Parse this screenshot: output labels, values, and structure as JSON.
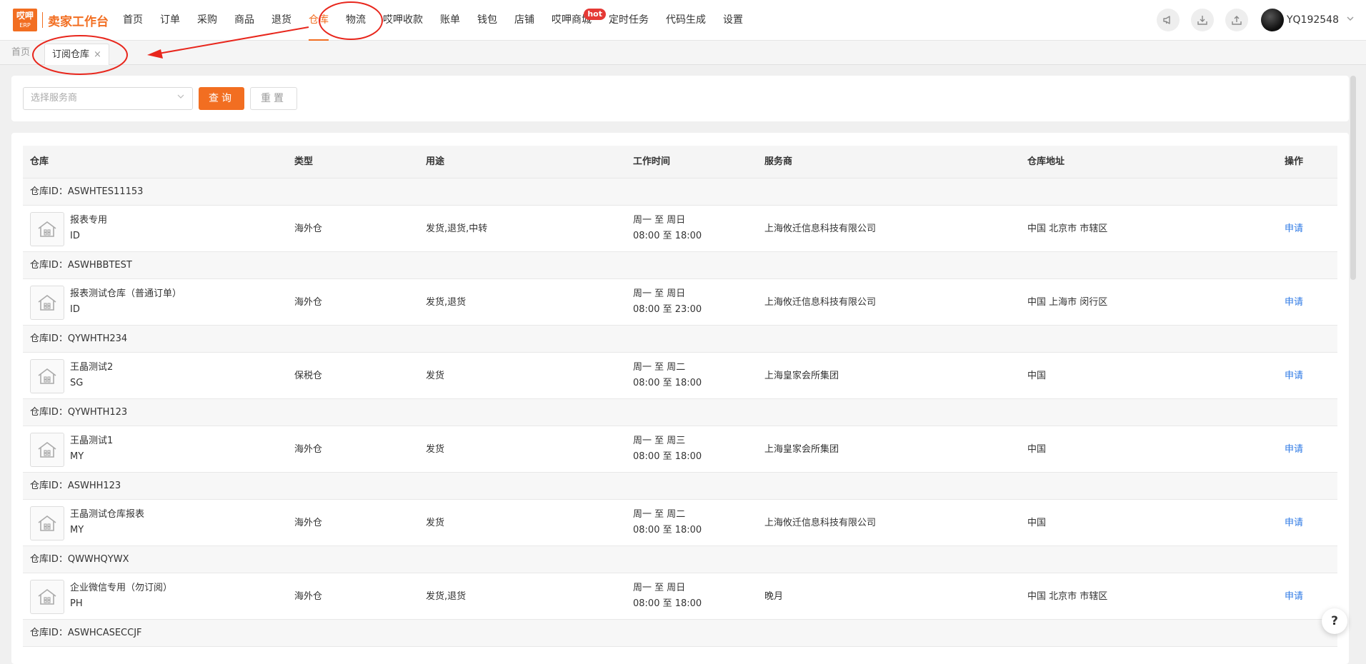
{
  "brand": {
    "logo_line1": "哎呷",
    "logo_line2": "ERP",
    "title": "卖家工作台"
  },
  "colors": {
    "accent": "#f26e21",
    "link": "#2f7ae5",
    "annotation": "#e8261c"
  },
  "nav": [
    {
      "label": "首页"
    },
    {
      "label": "订单"
    },
    {
      "label": "采购"
    },
    {
      "label": "商品"
    },
    {
      "label": "退货"
    },
    {
      "label": "仓库",
      "active": true
    },
    {
      "label": "物流"
    },
    {
      "label": "哎呷收款"
    },
    {
      "label": "账单"
    },
    {
      "label": "钱包"
    },
    {
      "label": "店铺"
    },
    {
      "label": "哎呷商城",
      "badge": "hot"
    },
    {
      "label": "定时任务"
    },
    {
      "label": "代码生成"
    },
    {
      "label": "设置"
    }
  ],
  "top_right": {
    "icons": [
      "megaphone-icon",
      "download-icon",
      "upload-icon"
    ],
    "username": "YQ192548"
  },
  "tabs": {
    "home": "首页",
    "active": "订阅仓库",
    "close": "×"
  },
  "filter": {
    "provider_placeholder": "选择服务商",
    "query_label": "查询",
    "reset_label": "重置"
  },
  "table": {
    "columns": [
      "仓库",
      "类型",
      "用途",
      "工作时间",
      "服务商",
      "仓库地址",
      "操作"
    ],
    "groups": [
      {
        "id_label": "仓库ID：ASWHTES11153",
        "name": "报表专用",
        "code": "ID",
        "type": "海外仓",
        "use": "发货,退货,中转",
        "days": "周一 至 周日",
        "hours": "08:00 至 18:00",
        "provider": "上海攸迁信息科技有限公司",
        "address": "中国 北京市 市辖区",
        "action": "申请"
      },
      {
        "id_label": "仓库ID：ASWHBBTEST",
        "name": "报表测试仓库（普通订单）",
        "code": "ID",
        "type": "海外仓",
        "use": "发货,退货",
        "days": "周一 至 周日",
        "hours": "08:00 至 23:00",
        "provider": "上海攸迁信息科技有限公司",
        "address": "中国 上海市 闵行区",
        "action": "申请"
      },
      {
        "id_label": "仓库ID：QYWHTH234",
        "name": "王晶测试2",
        "code": "SG",
        "type": "保税仓",
        "use": "发货",
        "days": "周一 至 周二",
        "hours": "08:00 至 18:00",
        "provider": "上海皇家会所集团",
        "address": "中国",
        "action": "申请"
      },
      {
        "id_label": "仓库ID：QYWHTH123",
        "name": "王晶测试1",
        "code": "MY",
        "type": "海外仓",
        "use": "发货",
        "days": "周一 至 周三",
        "hours": "08:00 至 18:00",
        "provider": "上海皇家会所集团",
        "address": "中国",
        "action": "申请"
      },
      {
        "id_label": "仓库ID：ASWHH123",
        "name": "王晶测试仓库报表",
        "code": "MY",
        "type": "海外仓",
        "use": "发货",
        "days": "周一 至 周二",
        "hours": "08:00 至 18:00",
        "provider": "上海攸迁信息科技有限公司",
        "address": "中国",
        "action": "申请"
      },
      {
        "id_label": "仓库ID：QWWHQYWX",
        "name": "企业微信专用（勿订阅）",
        "code": "PH",
        "type": "海外仓",
        "use": "发货,退货",
        "days": "周一 至 周日",
        "hours": "08:00 至 18:00",
        "provider": "晚月",
        "address": "中国 北京市 市辖区",
        "action": "申请"
      },
      {
        "id_label": "仓库ID：ASWHCASECCJF"
      }
    ]
  },
  "help": "?"
}
